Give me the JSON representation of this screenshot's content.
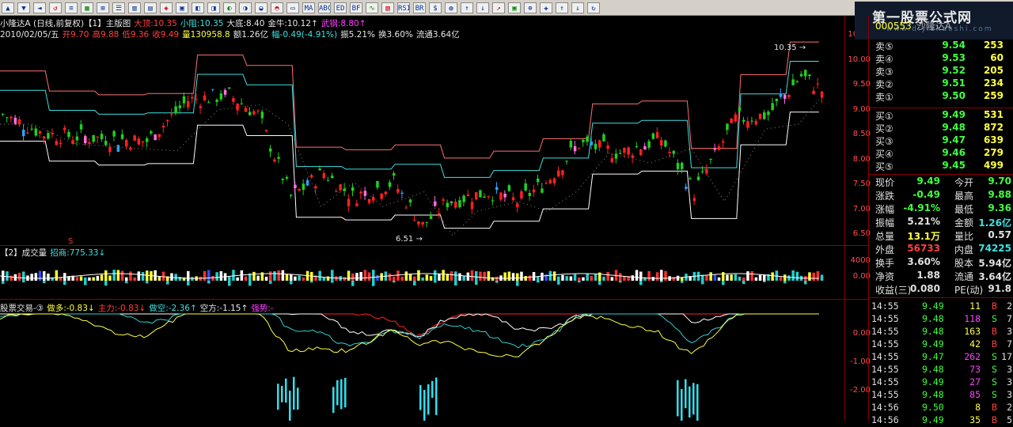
{
  "toolbar": {
    "buttons": [
      "▲",
      "▼",
      "◄",
      "↺",
      "≡",
      "▦",
      "⊞",
      "☰",
      "▥",
      "▤",
      "◈",
      "▣",
      "◧",
      "◨",
      "◐",
      "◑",
      "◒",
      "◓",
      "▭",
      "MA",
      "ABC",
      "ED",
      "BF",
      "∿",
      "▧",
      "RSI",
      "BR",
      "$",
      "◍",
      "↑",
      "↓",
      "↗",
      "▣",
      "⊕",
      "✚",
      "↑",
      "↓",
      "↻"
    ]
  },
  "watermark": {
    "title": "第一股票公式网",
    "url": "www.diyizhaoshi.com"
  },
  "chart": {
    "title_row": [
      {
        "t": "小隆达A (日线,前复权)【1】主版图",
        "c": "c-white"
      },
      {
        "t": "大顶:10.35",
        "c": "c-red"
      },
      {
        "t": "小阻:10.35",
        "c": "c-cyan"
      },
      {
        "t": "大底:8.40",
        "c": "c-white"
      },
      {
        "t": "金牛:10.12↑",
        "c": "c-white"
      },
      {
        "t": "武钢:8.80↑",
        "c": "c-mag"
      }
    ],
    "info_row": [
      {
        "t": "2010/02/05/五",
        "c": "c-white"
      },
      {
        "t": "开9.70",
        "c": "c-red"
      },
      {
        "t": "高9.88",
        "c": "c-red"
      },
      {
        "t": "低9.36",
        "c": "c-red"
      },
      {
        "t": "收9.49",
        "c": "c-red"
      },
      {
        "t": "量130958.8",
        "c": "c-yellow"
      },
      {
        "t": "额1.26亿",
        "c": "c-white"
      },
      {
        "t": "幅-0.49(-4.91%)",
        "c": "c-cyan"
      },
      {
        "t": "振5.21%",
        "c": "c-white"
      },
      {
        "t": "换3.60%",
        "c": "c-white"
      },
      {
        "t": "流通3.64亿",
        "c": "c-white"
      }
    ],
    "high_label": "10.35",
    "low_label": "6.51",
    "sell_marker": "S",
    "price_axis": [
      "10.50",
      "10.00",
      "9.50",
      "9.00",
      "8.50",
      "8.00",
      "7.50",
      "7.00",
      "6.50"
    ],
    "vol_row": [
      {
        "t": "【2】成交量",
        "c": "c-white"
      },
      {
        "t": "招商:775.33↓",
        "c": "c-cyan"
      }
    ],
    "vol_axis": [
      "4000",
      "0.00"
    ],
    "ind_row": [
      {
        "t": "股票交易-③",
        "c": "c-white"
      },
      {
        "t": "做多:-0.83↓",
        "c": "c-yellow"
      },
      {
        "t": "主力:-0.83↓",
        "c": "c-red"
      },
      {
        "t": "做空:-2.36↑",
        "c": "c-cyan"
      },
      {
        "t": "空方:-1.15↑",
        "c": "c-white"
      },
      {
        "t": "强势:-",
        "c": "c-mag"
      }
    ],
    "ind_axis": [
      "0.00",
      "-1.00",
      "-2.00"
    ]
  },
  "quote": {
    "code": "000553",
    "name": "沙隆达A",
    "sell": [
      {
        "l": "卖⑤",
        "p": "9.54",
        "v": "253"
      },
      {
        "l": "卖④",
        "p": "9.53",
        "v": "60"
      },
      {
        "l": "卖③",
        "p": "9.52",
        "v": "205"
      },
      {
        "l": "卖②",
        "p": "9.51",
        "v": "234"
      },
      {
        "l": "卖①",
        "p": "9.50",
        "v": "259"
      }
    ],
    "buy": [
      {
        "l": "买①",
        "p": "9.49",
        "v": "531"
      },
      {
        "l": "买②",
        "p": "9.48",
        "v": "872"
      },
      {
        "l": "买③",
        "p": "9.47",
        "v": "639"
      },
      {
        "l": "买④",
        "p": "9.46",
        "v": "279"
      },
      {
        "l": "买⑤",
        "p": "9.45",
        "v": "499"
      }
    ],
    "stats": [
      {
        "l1": "现价",
        "v1": "9.49",
        "c1": "#40ff40",
        "l2": "今开",
        "v2": "9.70",
        "c2": "#40ff40"
      },
      {
        "l1": "涨跌",
        "v1": "-0.49",
        "c1": "#40ff40",
        "l2": "最高",
        "v2": "9.88",
        "c2": "#40ff40"
      },
      {
        "l1": "涨幅",
        "v1": "-4.91%",
        "c1": "#40ff40",
        "l2": "最低",
        "v2": "9.36",
        "c2": "#40ff40"
      },
      {
        "l1": "振幅",
        "v1": "5.21%",
        "c1": "#e0e0e0",
        "l2": "金额",
        "v2": "1.26亿",
        "c2": "#40e0e0"
      },
      {
        "l1": "总量",
        "v1": "13.1万",
        "c1": "#ffff40",
        "l2": "量比",
        "v2": "0.57",
        "c2": "#e0e0e0"
      },
      {
        "l1": "外盘",
        "v1": "56733",
        "c1": "#ff4040",
        "l2": "内盘",
        "v2": "74225",
        "c2": "#40e0e0"
      },
      {
        "l1": "换手",
        "v1": "3.60%",
        "c1": "#e0e0e0",
        "l2": "股本",
        "v2": "5.94亿",
        "c2": "#e0e0e0"
      },
      {
        "l1": "净资",
        "v1": "1.88",
        "c1": "#e0e0e0",
        "l2": "流通",
        "v2": "3.64亿",
        "c2": "#e0e0e0"
      },
      {
        "l1": "收益(三)",
        "v1": "0.080",
        "c1": "#e0e0e0",
        "l2": "PE(动)",
        "v2": "91.8",
        "c2": "#e0e0e0"
      }
    ],
    "ticks": [
      {
        "t": "14:55",
        "p": "9.49",
        "v": "11",
        "bs": "B",
        "n": "2"
      },
      {
        "t": "14:55",
        "p": "9.48",
        "v": "118",
        "bs": "S",
        "n": "7"
      },
      {
        "t": "14:55",
        "p": "9.48",
        "v": "163",
        "bs": "B",
        "n": "3"
      },
      {
        "t": "14:55",
        "p": "9.49",
        "v": "42",
        "bs": "B",
        "n": "7"
      },
      {
        "t": "14:55",
        "p": "9.47",
        "v": "262",
        "bs": "S",
        "n": "17"
      },
      {
        "t": "14:55",
        "p": "9.48",
        "v": "73",
        "bs": "S",
        "n": "3"
      },
      {
        "t": "14:55",
        "p": "9.49",
        "v": "27",
        "bs": "S",
        "n": "3"
      },
      {
        "t": "14:55",
        "p": "9.48",
        "v": "85",
        "bs": "S",
        "n": "3"
      },
      {
        "t": "14:56",
        "p": "9.50",
        "v": "8",
        "bs": "B",
        "n": "2"
      },
      {
        "t": "14:56",
        "p": "9.49",
        "v": "35",
        "bs": "B",
        "n": "5"
      }
    ]
  }
}
